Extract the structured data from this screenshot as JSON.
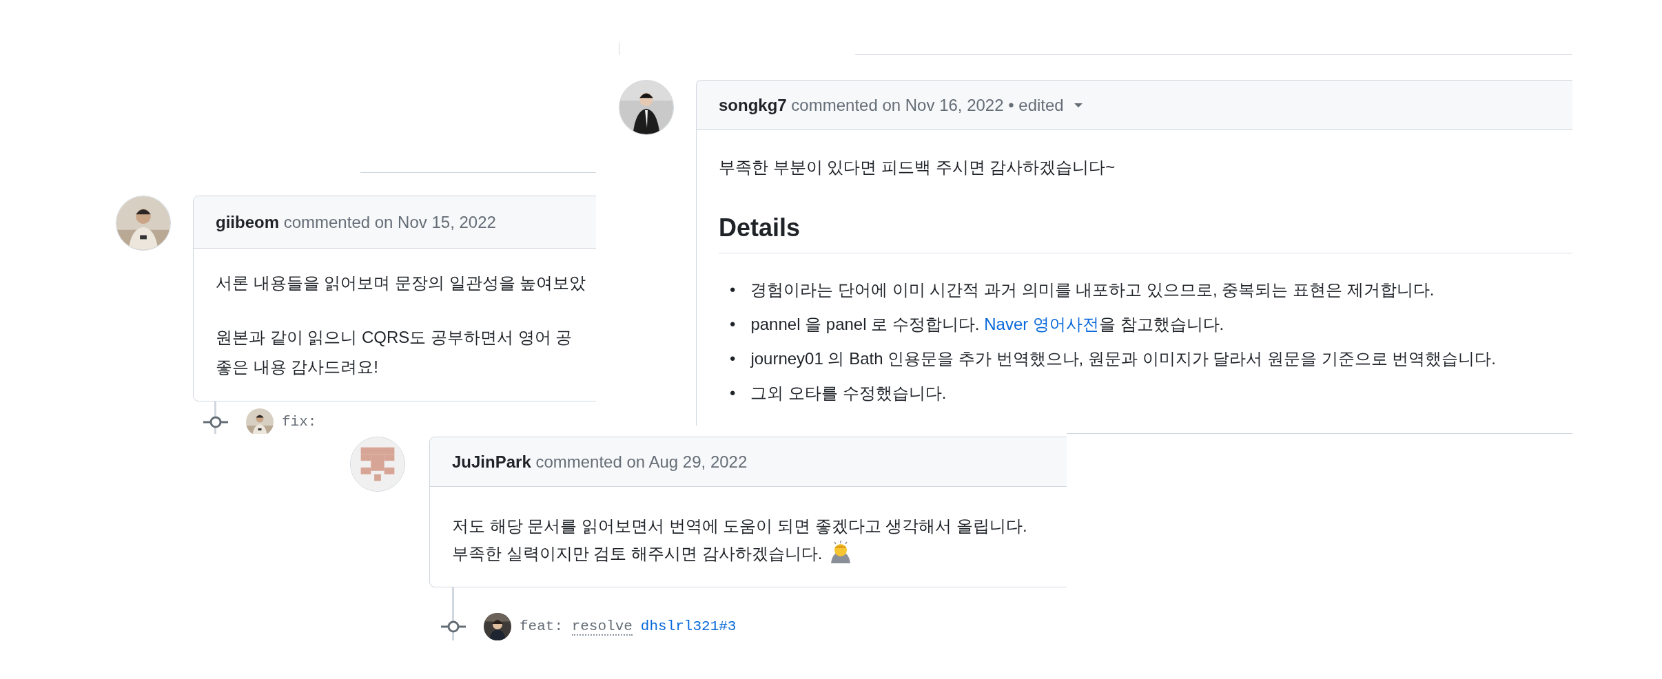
{
  "panels": [
    {
      "author": "giibeom",
      "action": "commented on Nov 15, 2022",
      "edited": false,
      "paragraphs": [
        [
          "서론 내용들을 읽어보며 문장의 일관성을 높여보았"
        ],
        [
          "원본과 같이 읽으니 CQRS도 공부하면서 영어 공",
          "좋은 내용 감사드려요!"
        ]
      ],
      "commit": {
        "message": [
          {
            "text": "fix:"
          }
        ]
      }
    },
    {
      "author": "songkg7",
      "action": "commented on Nov 16, 2022",
      "edited": true,
      "edited_label": "• edited",
      "paragraphs": [
        [
          "부족한 부분이 있다면 피드백 주시면 감사하겠습니다~"
        ]
      ],
      "heading": "Details",
      "bullets": [
        {
          "marker": "•",
          "segments": [
            {
              "text": "경험이라는 단어에 이미 시간적 과거 의미를 내포하고 있으므로, 중복되는 표현은 제거합니다."
            }
          ]
        },
        {
          "marker": "•",
          "segments": [
            {
              "text": "pannel 을 panel 로 수정합니다. "
            },
            {
              "text": "Naver 영어사전",
              "kind": "link"
            },
            {
              "text": "을 참고했습니다."
            }
          ]
        },
        {
          "marker": "•",
          "segments": [
            {
              "text": "journey01 의 Bath 인용문을 추가 번역했으나, 원문과 이미지가 달라서 원문을 기준으로 번역했습니다."
            }
          ]
        },
        {
          "marker": "•",
          "segments": [
            {
              "text": "그외 오타를 수정했습니다."
            }
          ]
        }
      ]
    },
    {
      "author": "JuJinPark",
      "action": "commented on Aug 29, 2022",
      "edited": false,
      "paragraphs": [
        [
          "저도 해당 문서를 읽어보면서 번역에 도움이 되면 좋겠다고 생각해서 올립니다.",
          "부족한 실력이지만 검토 해주시면 감사하겠습니다."
        ]
      ],
      "commit": {
        "message": [
          {
            "text": "feat: "
          },
          {
            "text": "resolve",
            "kind": "abbr"
          },
          {
            "text": "dhslrl321#3",
            "kind": "link"
          }
        ]
      }
    }
  ]
}
